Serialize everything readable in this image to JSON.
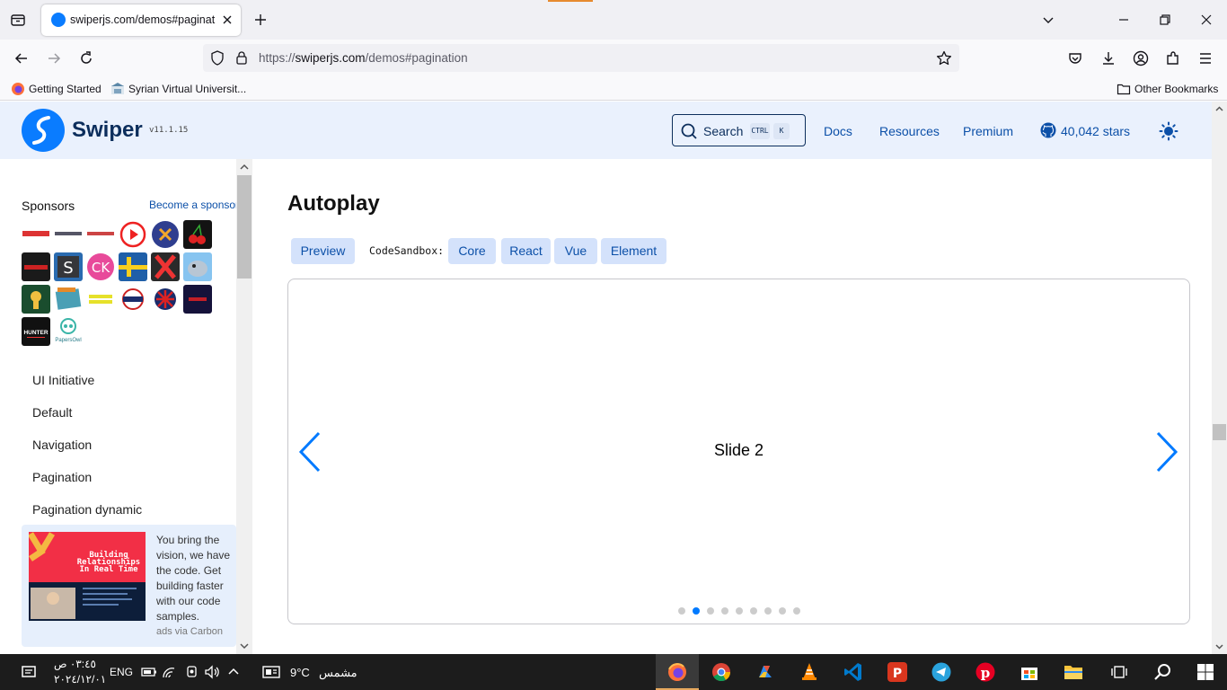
{
  "browser": {
    "tab_title": "swiperjs.com/demos#paginatio",
    "url_scheme": "https://",
    "url_host": "swiperjs.com",
    "url_path": "/demos#pagination",
    "bookmarks": [
      {
        "label": "Getting Started",
        "icon": "firefox-icon"
      },
      {
        "label": "Syrian Virtual Universit...",
        "icon": "university-icon"
      }
    ],
    "other_bookmarks": "Other Bookmarks"
  },
  "header": {
    "logo_text": "Swiper",
    "version": "v11.1.15",
    "search_label": "Search",
    "search_kbd": [
      "CTRL",
      "K"
    ],
    "links": [
      "Docs",
      "Resources",
      "Premium"
    ],
    "stars": "40,042 stars"
  },
  "sidebar": {
    "sponsors_title": "Sponsors",
    "become_sponsor": "Become a sponsor",
    "sponsor_texts": {
      "hunter": "HUNTER",
      "papersowl": "PapersOwl"
    },
    "nav": [
      "UI Initiative",
      "Default",
      "Navigation",
      "Pagination",
      "Pagination dynamic"
    ],
    "carbon": {
      "text": "You bring the vision, we have the code. Get building faster with our code samples.",
      "attribution": "ads via Carbon",
      "image_text": "Building Relationships In Real Time"
    }
  },
  "main": {
    "title": "Autoplay",
    "preview": "Preview",
    "codesandbox_label": "CodeSandbox:",
    "sandboxes": [
      "Core",
      "React",
      "Vue",
      "Element"
    ],
    "slide_text": "Slide 2",
    "pagination": {
      "total": 9,
      "active_index": 1
    }
  },
  "taskbar": {
    "time": "٠٣:٤٥ ص",
    "date": "٢٠٢٤/١٢/٠١",
    "language": "ENG",
    "weather_temp": "9°C",
    "weather_desc": "مشمس"
  },
  "colors": {
    "swiper_blue": "#0a7cff",
    "swiper_navy": "#0c2e5c",
    "link_blue": "#0c50a8",
    "bullet_active": "#007aff"
  }
}
